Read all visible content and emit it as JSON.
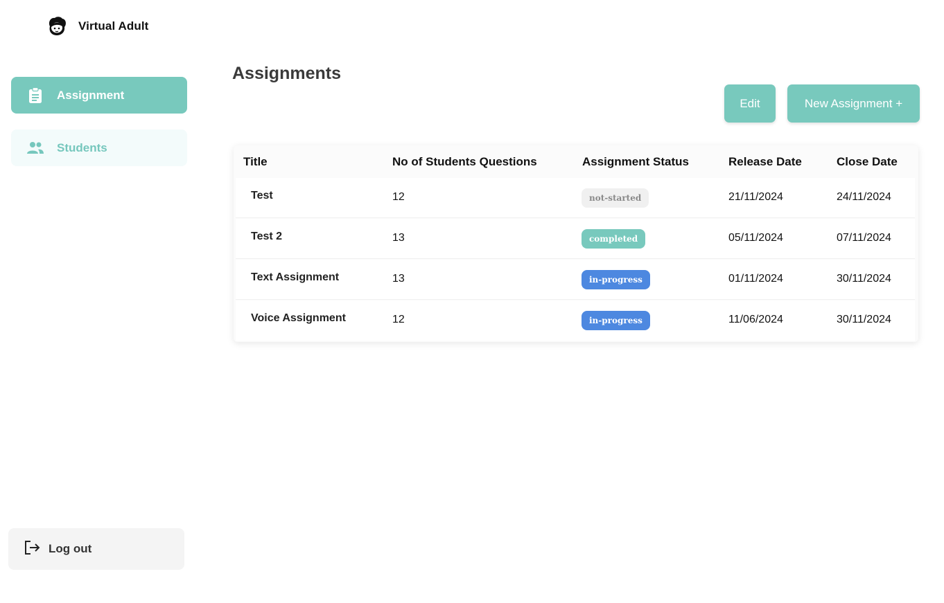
{
  "app": {
    "name": "Virtual Adult"
  },
  "sidebar": {
    "items": [
      {
        "label": "Assignment",
        "icon": "clipboard-icon",
        "active": true
      },
      {
        "label": "Students",
        "icon": "users-icon",
        "active": false
      }
    ],
    "logout": {
      "label": "Log out",
      "icon": "logout-icon"
    }
  },
  "main": {
    "title": "Assignments",
    "buttons": {
      "edit": "Edit",
      "new_assignment": "New Assignment +"
    },
    "table": {
      "headers": [
        "Title",
        "No of Students Questions",
        "Assignment Status",
        "Release Date",
        "Close Date"
      ],
      "rows": [
        {
          "title": "Test",
          "questions": "12",
          "status": "not-started",
          "release": "21/11/2024",
          "close": "24/11/2024"
        },
        {
          "title": "Test 2",
          "questions": "13",
          "status": "completed",
          "release": "05/11/2024",
          "close": "07/11/2024"
        },
        {
          "title": "Text Assignment",
          "questions": "13",
          "status": "in-progress",
          "release": "01/11/2024",
          "close": "30/11/2024"
        },
        {
          "title": "Voice Assignment",
          "questions": "12",
          "status": "in-progress",
          "release": "11/06/2024",
          "close": "30/11/2024"
        }
      ]
    }
  },
  "colors": {
    "accent": "#78c9bd",
    "status_in_progress": "#4d88e0",
    "status_not_started": "#f0f0f0"
  }
}
